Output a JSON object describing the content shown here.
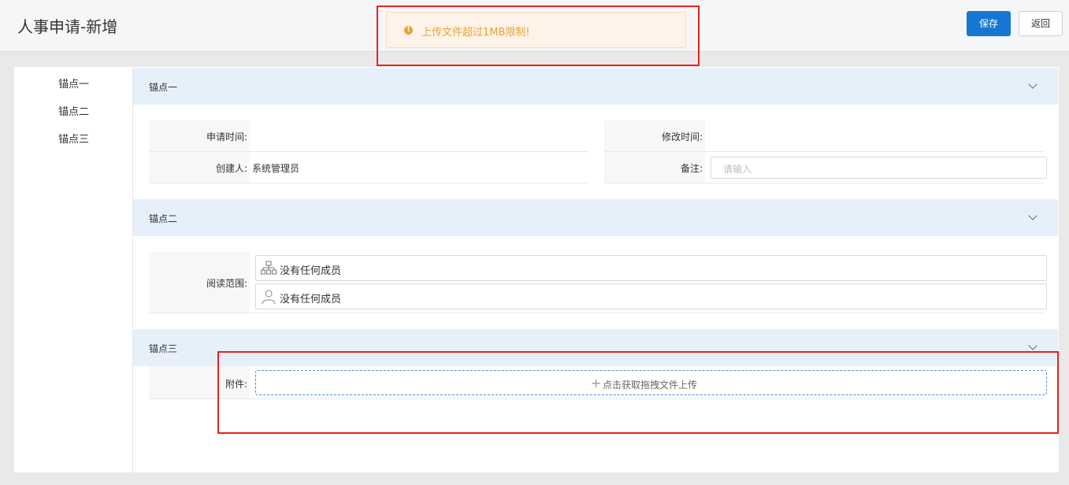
{
  "header": {
    "title": "人事申请-新增",
    "save_label": "保存",
    "back_label": "返回"
  },
  "toast": {
    "icon": "warning-icon",
    "message": "上传文件超过1MB限制!",
    "color": "#e6a23c"
  },
  "anchor_nav": {
    "items": [
      {
        "label": "锚点一"
      },
      {
        "label": "锚点二"
      },
      {
        "label": "锚点三"
      }
    ]
  },
  "sections": {
    "one": {
      "title": "锚点一",
      "apply_time_label": "申请时间:",
      "apply_time_value": "",
      "modify_time_label": "修改时间:",
      "modify_time_value": "",
      "creator_label": "创建人:",
      "creator_value": "系统管理员",
      "remark_label": "备注:",
      "remark_placeholder": "请输入"
    },
    "two": {
      "title": "锚点二",
      "read_scope_label": "阅读范围:",
      "org_members_text": "没有任何成员",
      "user_members_text": "没有任何成员"
    },
    "three": {
      "title": "锚点三",
      "attachment_label": "附件:",
      "upload_plus": "+",
      "upload_text": "点击获取拖拽文件上传"
    }
  },
  "colors": {
    "primary": "#1677d2",
    "section_header_bg": "#e6f0fa",
    "highlight_red": "#e8211e",
    "upload_border": "#4a90d9"
  }
}
